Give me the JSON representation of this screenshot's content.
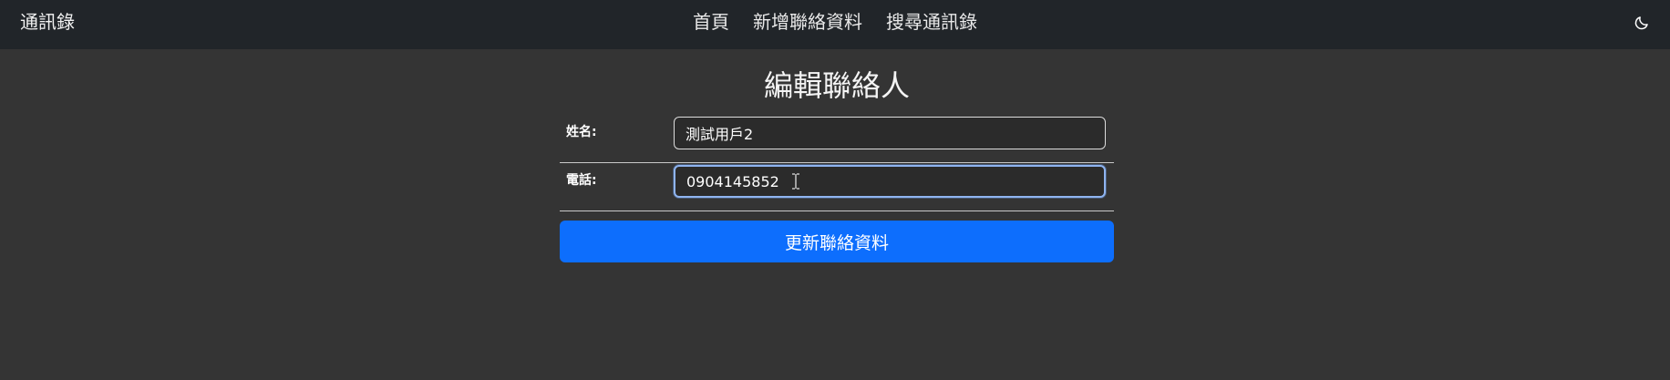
{
  "navbar": {
    "brand": "通訊錄",
    "links": [
      "首頁",
      "新增聯絡資料",
      "搜尋通訊錄"
    ],
    "theme_icon": "moon-icon"
  },
  "form": {
    "title": "編輯聯絡人",
    "name_label": "姓名:",
    "name_value": "測試用戶2",
    "phone_label": "電話:",
    "phone_value": "0904145852",
    "submit_label": "更新聯絡資料"
  },
  "colors": {
    "navbar_bg": "#212529",
    "page_bg": "#343434",
    "primary_button": "#0d6efd"
  }
}
